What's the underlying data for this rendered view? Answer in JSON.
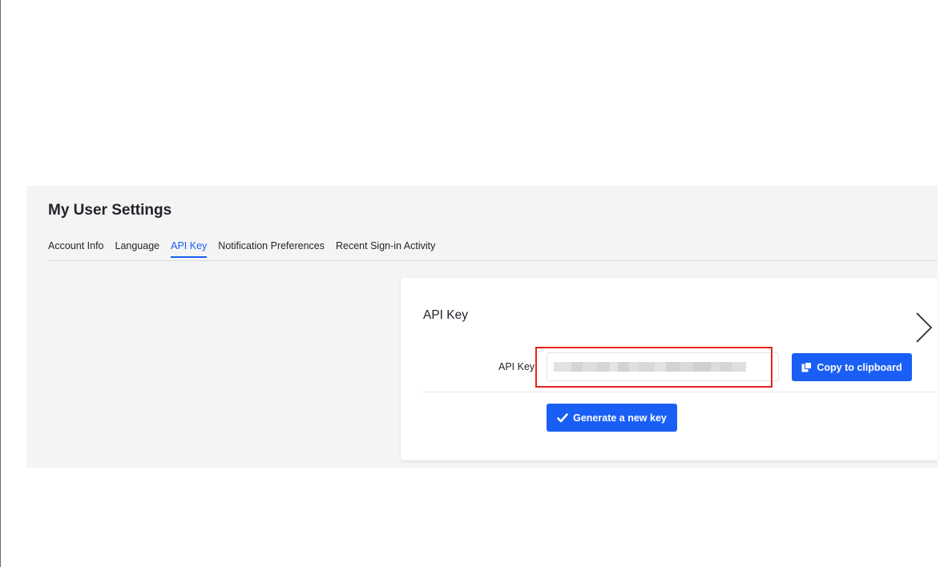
{
  "page": {
    "title": "My User Settings"
  },
  "tabs": [
    {
      "label": "Account Info",
      "active": false
    },
    {
      "label": "Language",
      "active": false
    },
    {
      "label": "API Key",
      "active": true
    },
    {
      "label": "Notification Preferences",
      "active": false
    },
    {
      "label": "Recent Sign-in Activity",
      "active": false
    }
  ],
  "api_key_card": {
    "title": "API Key",
    "field_label": "API Key",
    "copy_button_label": "Copy to clipboard",
    "copy_button_icon": "clipboard-icon",
    "generate_button_label": "Generate a new key",
    "generate_button_icon": "checkmark-icon",
    "next_icon": "chevron-right-icon"
  },
  "colors": {
    "accent": "#1a5ff5",
    "highlight": "#e8231e",
    "panel_background": "#f4f4f4"
  }
}
